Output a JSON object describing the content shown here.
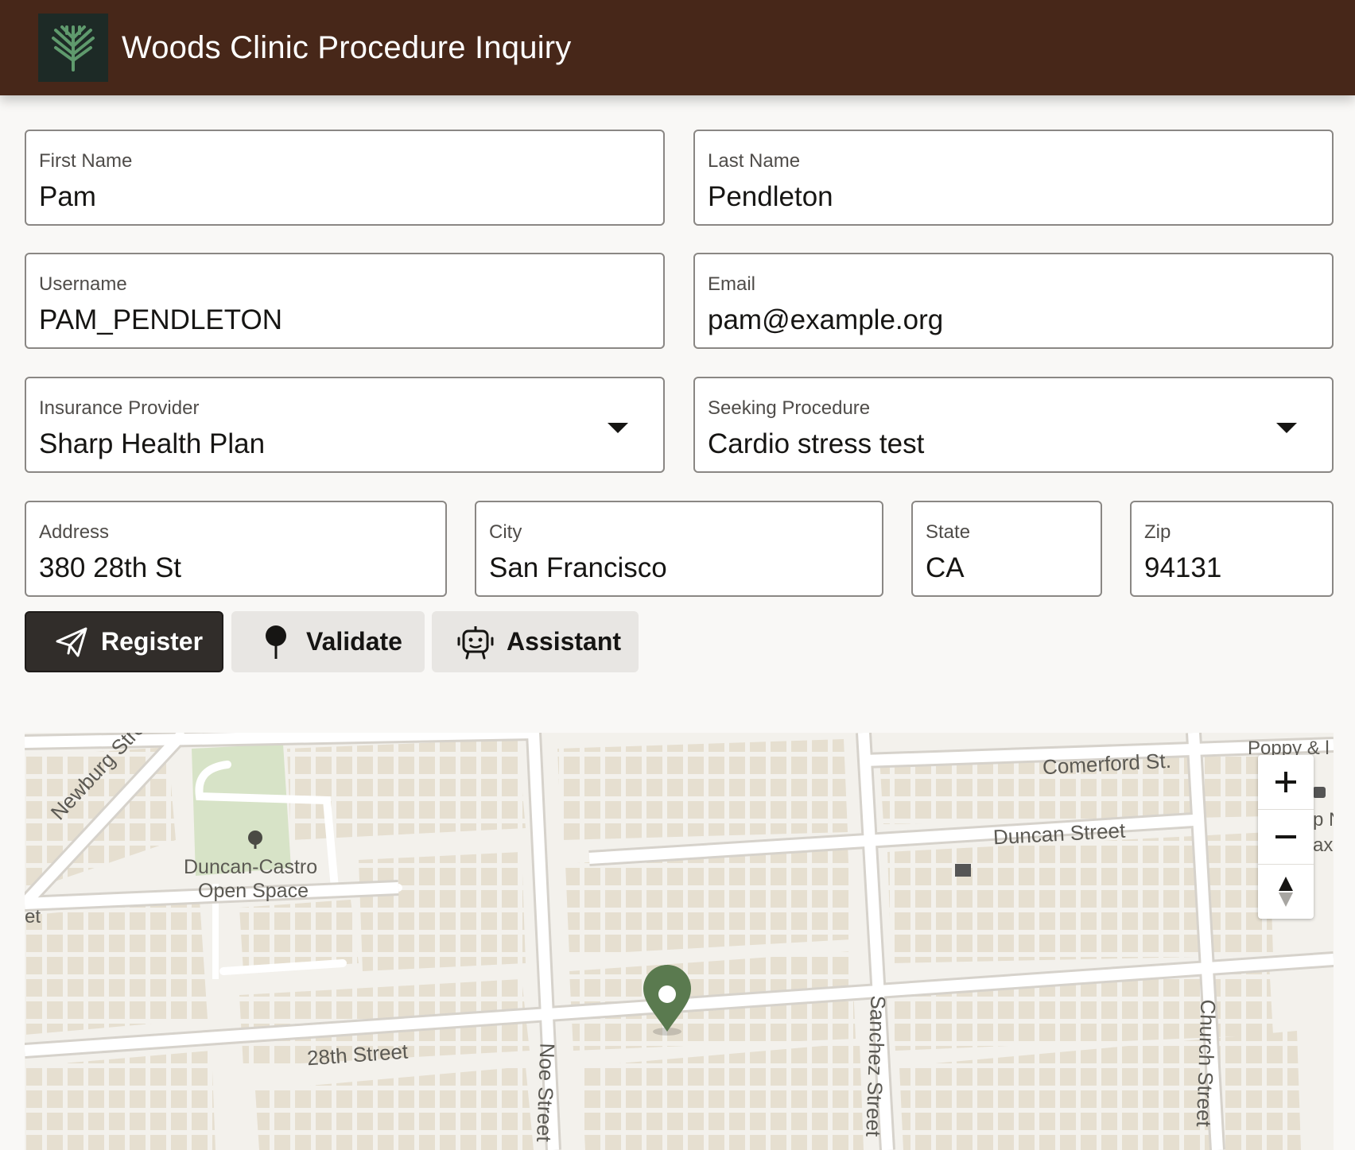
{
  "app": {
    "title": "Woods Clinic Procedure Inquiry",
    "logo_icon": "tree-logo-icon",
    "header_color": "#472719"
  },
  "form": {
    "first_name": {
      "label": "First Name",
      "value": "Pam"
    },
    "last_name": {
      "label": "Last Name",
      "value": "Pendleton"
    },
    "username": {
      "label": "Username",
      "value": "PAM_PENDLETON"
    },
    "email": {
      "label": "Email",
      "value": "pam@example.org"
    },
    "insurance_provider": {
      "label": "Insurance Provider",
      "value": "Sharp Health Plan"
    },
    "seeking_procedure": {
      "label": "Seeking Procedure",
      "value": "Cardio stress test"
    },
    "address": {
      "label": "Address",
      "value": "380 28th St"
    },
    "city": {
      "label": "City",
      "value": "San Francisco"
    },
    "state": {
      "label": "State",
      "value": "CA"
    },
    "zip": {
      "label": "Zip",
      "value": "94131"
    }
  },
  "actions": {
    "register": {
      "label": "Register",
      "icon": "paper-plane-icon"
    },
    "validate": {
      "label": "Validate",
      "icon": "map-pin-icon"
    },
    "assistant": {
      "label": "Assistant",
      "icon": "robot-icon"
    }
  },
  "map": {
    "labels": {
      "comerford": "Comerford St.",
      "poppy": "Poppy & l",
      "duncan": "Duncan Street",
      "newburg": "Newburg Street",
      "park_line1": "Duncan-Castro",
      "park_line2": "Open Space",
      "street_28th": "28th Street",
      "noe": "Noe Street",
      "sanchez": "Sanchez Street",
      "church": "Church Street",
      "cut_left": "et",
      "cut_right1": "p N",
      "cut_right2": "ax"
    },
    "controls": {
      "zoom_in": "plus-icon",
      "zoom_out": "minus-icon",
      "compass": "compass-icon"
    },
    "marker_color": "#5a7a4f"
  }
}
